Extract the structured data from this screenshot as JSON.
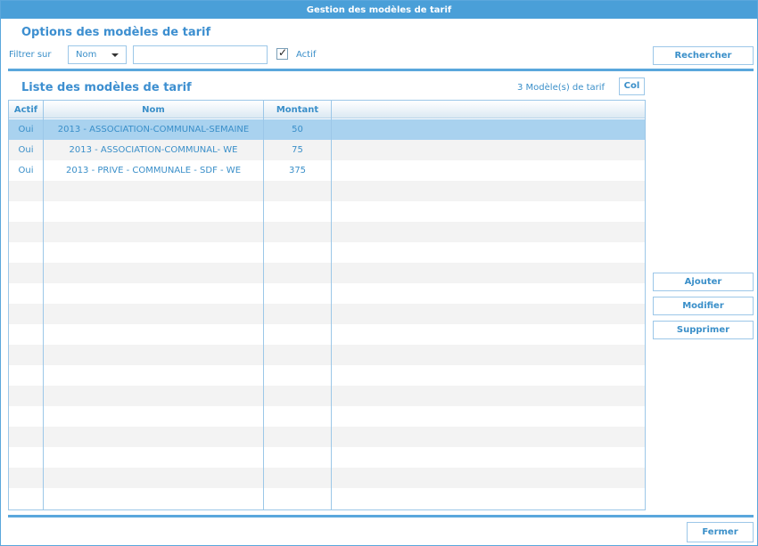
{
  "window": {
    "title": "Gestion des modèles de tarif"
  },
  "options": {
    "title": "Options des modèles de tarif",
    "filter_label": "Filtrer sur",
    "filter_field": "Nom",
    "filter_value": "",
    "active_checked": true,
    "active_label": "Actif",
    "search_button": "Rechercher"
  },
  "list": {
    "title": "Liste des modèles de tarif",
    "count_label": "3 Modèle(s) de tarif",
    "col_button": "Col",
    "columns": [
      "Actif",
      "Nom",
      "Montant"
    ],
    "rows": [
      {
        "actif": "Oui",
        "nom": "2013 - ASSOCIATION-COMMUNAL-SEMAINE",
        "montant": "50",
        "selected": true
      },
      {
        "actif": "Oui",
        "nom": "2013 - ASSOCIATION-COMMUNAL- WE",
        "montant": "75",
        "selected": false
      },
      {
        "actif": "Oui",
        "nom": "2013 - PRIVE - COMMUNALE - SDF - WE",
        "montant": "375",
        "selected": false
      }
    ]
  },
  "actions": {
    "add": "Ajouter",
    "edit": "Modifier",
    "delete": "Supprimer",
    "close": "Fermer"
  },
  "colors": {
    "accent": "#4a9fd8",
    "selection": "#a9d2ef",
    "text": "#3a8fc9"
  }
}
